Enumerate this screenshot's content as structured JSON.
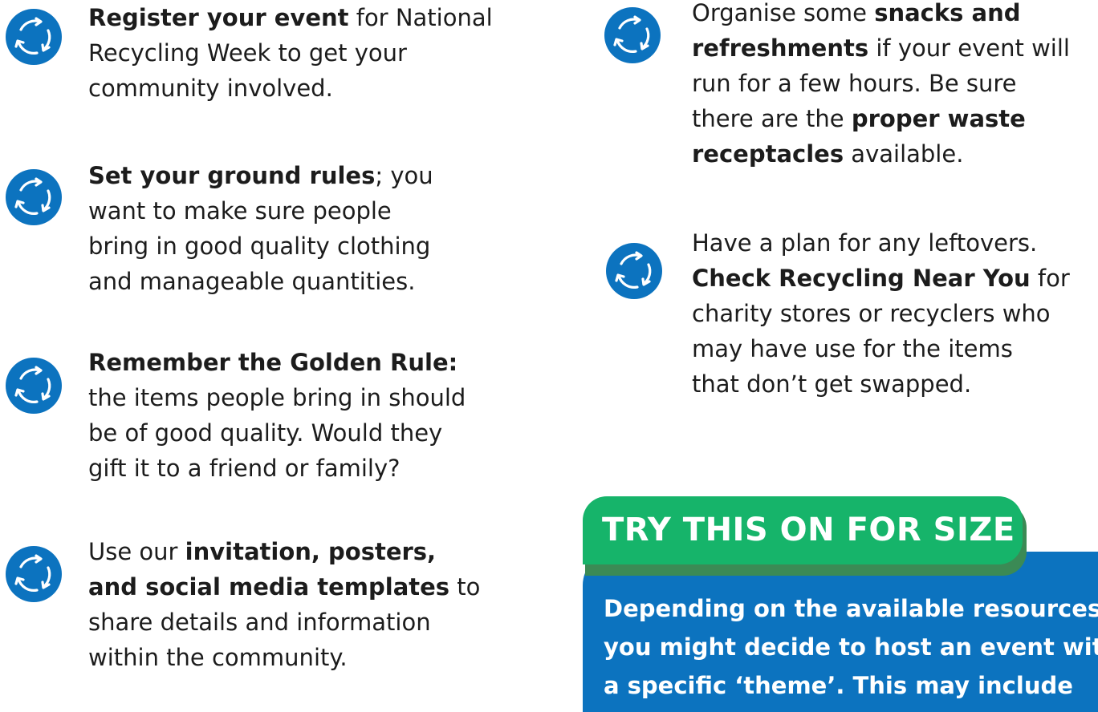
{
  "colors": {
    "icon_blue": "#0c73bf",
    "badge_green": "#16b46a",
    "panel_blue": "#0c73bf"
  },
  "items": [
    {
      "icon": "recycle-icon",
      "lines": [
        [
          {
            "b": "Register your event"
          },
          {
            "t": " for National"
          }
        ],
        [
          {
            "t": "Recycling Week to get your"
          }
        ],
        [
          {
            "t": "community involved."
          }
        ]
      ]
    },
    {
      "icon": "recycle-icon",
      "lines": [
        [
          {
            "b": "Set your ground rules"
          },
          {
            "t": "; you"
          }
        ],
        [
          {
            "t": "want to make sure people"
          }
        ],
        [
          {
            "t": "bring in good quality clothing"
          }
        ],
        [
          {
            "t": "and manageable quantities."
          }
        ]
      ]
    },
    {
      "icon": "recycle-icon",
      "lines": [
        [
          {
            "b": "Remember the Golden Rule:"
          }
        ],
        [
          {
            "t": "the items people bring in should"
          }
        ],
        [
          {
            "t": "be of good quality. Would they"
          }
        ],
        [
          {
            "t": "gift it to a friend or family?"
          }
        ]
      ]
    },
    {
      "icon": "recycle-icon",
      "lines": [
        [
          {
            "t": "Use our "
          },
          {
            "b": "invitation, posters,"
          }
        ],
        [
          {
            "b": "and social media templates"
          },
          {
            "t": " to"
          }
        ],
        [
          {
            "t": "share details and information"
          }
        ],
        [
          {
            "t": "within the community."
          }
        ]
      ]
    },
    {
      "icon": "recycle-icon",
      "lines": [
        [
          {
            "t": "Organise some "
          },
          {
            "b": "snacks and"
          }
        ],
        [
          {
            "b": "refreshments"
          },
          {
            "t": " if your event will"
          }
        ],
        [
          {
            "t": "run for a few hours. Be sure"
          }
        ],
        [
          {
            "t": "there are the "
          },
          {
            "b": "proper waste"
          }
        ],
        [
          {
            "b": "receptacles"
          },
          {
            "t": " available."
          }
        ]
      ]
    },
    {
      "icon": "recycle-icon",
      "lines": [
        [
          {
            "t": "Have a plan for any leftovers."
          }
        ],
        [
          {
            "b": "Check Recycling Near You"
          },
          {
            "t": " for"
          }
        ],
        [
          {
            "t": "charity stores or recyclers who"
          }
        ],
        [
          {
            "t": "may have use for the items"
          }
        ],
        [
          {
            "t": "that don’t get swapped."
          }
        ]
      ]
    }
  ],
  "tip": {
    "heading": "TRY THIS ON FOR SIZE",
    "lines": [
      "Depending on the available resources,",
      "you might decide to host an event with",
      "a specific ‘theme’. This may include"
    ]
  }
}
